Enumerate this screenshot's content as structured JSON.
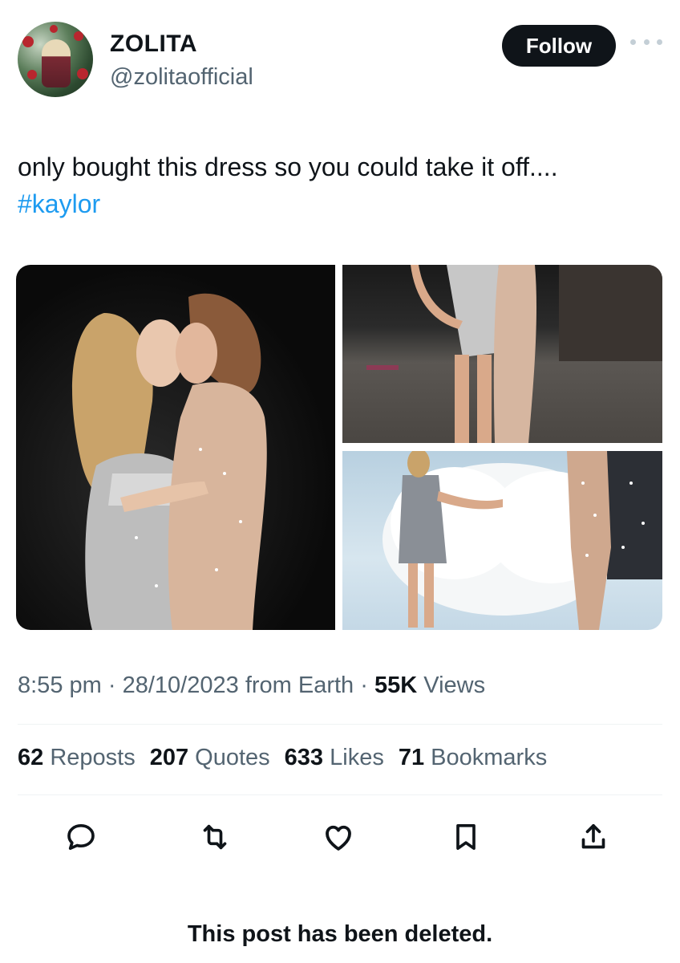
{
  "author": {
    "display_name": "ZOLITA",
    "handle": "@zolitaofficial",
    "avatar_icon": "profile-photo"
  },
  "header": {
    "follow_label": "Follow",
    "more_icon": "ellipsis-icon"
  },
  "tweet": {
    "text": "only bought this dress so you could take it off....",
    "hashtag": "#kaylor",
    "accent_color": "#1d9bf0"
  },
  "media": {
    "photo_count": 3
  },
  "meta": {
    "time": "8:55 pm",
    "date": "28/10/2023",
    "location": "from Earth",
    "views_count": "55K",
    "views_label": "Views",
    "separator": "·"
  },
  "stats": [
    {
      "count": "62",
      "label": "Reposts"
    },
    {
      "count": "207",
      "label": "Quotes"
    },
    {
      "count": "633",
      "label": "Likes"
    },
    {
      "count": "71",
      "label": "Bookmarks"
    }
  ],
  "actions": [
    {
      "icon": "reply-icon"
    },
    {
      "icon": "repost-icon"
    },
    {
      "icon": "like-icon"
    },
    {
      "icon": "bookmark-icon"
    },
    {
      "icon": "share-icon"
    }
  ],
  "footer": {
    "deleted_notice": "This post has been deleted."
  },
  "colors": {
    "text_primary": "#0f1419",
    "text_secondary": "#536471",
    "follow_bg": "#0f1419",
    "follow_text": "#ffffff"
  }
}
